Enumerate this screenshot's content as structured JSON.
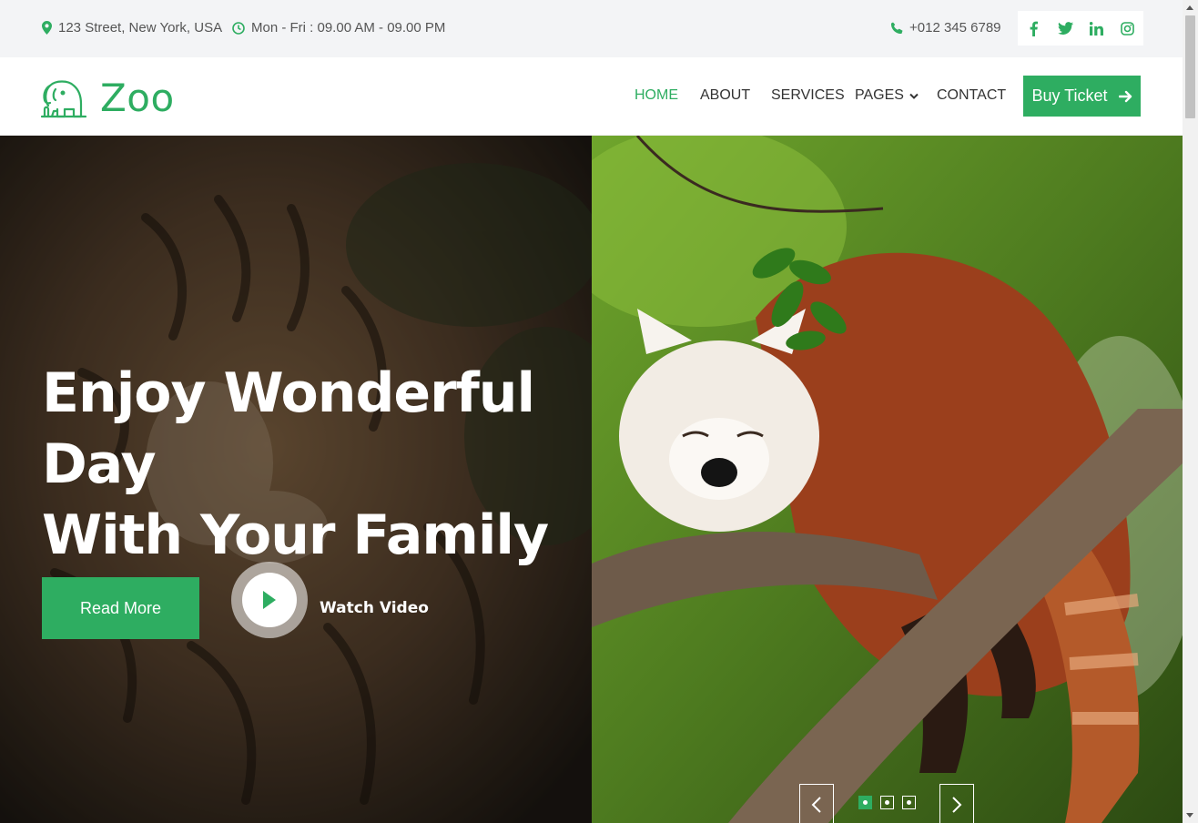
{
  "topbar": {
    "address": "123 Street, New York, USA",
    "hours": "Mon - Fri : 09.00 AM - 09.00 PM",
    "phone": "+012 345 6789",
    "social": [
      {
        "icon": "facebook-icon",
        "glyph": "f"
      },
      {
        "icon": "twitter-icon",
        "glyph": "t"
      },
      {
        "icon": "linkedin-icon",
        "glyph": "in"
      },
      {
        "icon": "instagram-icon",
        "glyph": "ig"
      }
    ]
  },
  "brand": {
    "name": "Zoo",
    "logo_icon": "elephant-icon"
  },
  "nav": {
    "items": [
      {
        "label": "HOME",
        "active": true
      },
      {
        "label": "ABOUT"
      },
      {
        "label": "SERVICES"
      },
      {
        "label": "PAGES",
        "has_dropdown": true
      },
      {
        "label": "CONTACT"
      }
    ],
    "cta": "Buy Ticket"
  },
  "hero": {
    "title_line1": "Enjoy Wonderful Day",
    "title_line2": "With Your Family",
    "primary_button": "Read More",
    "video_label": "Watch Video",
    "carousel": {
      "slide_count": 3,
      "active_index": 0
    }
  },
  "colors": {
    "accent": "#2ead61",
    "topbar_bg": "#f3f4f6"
  }
}
